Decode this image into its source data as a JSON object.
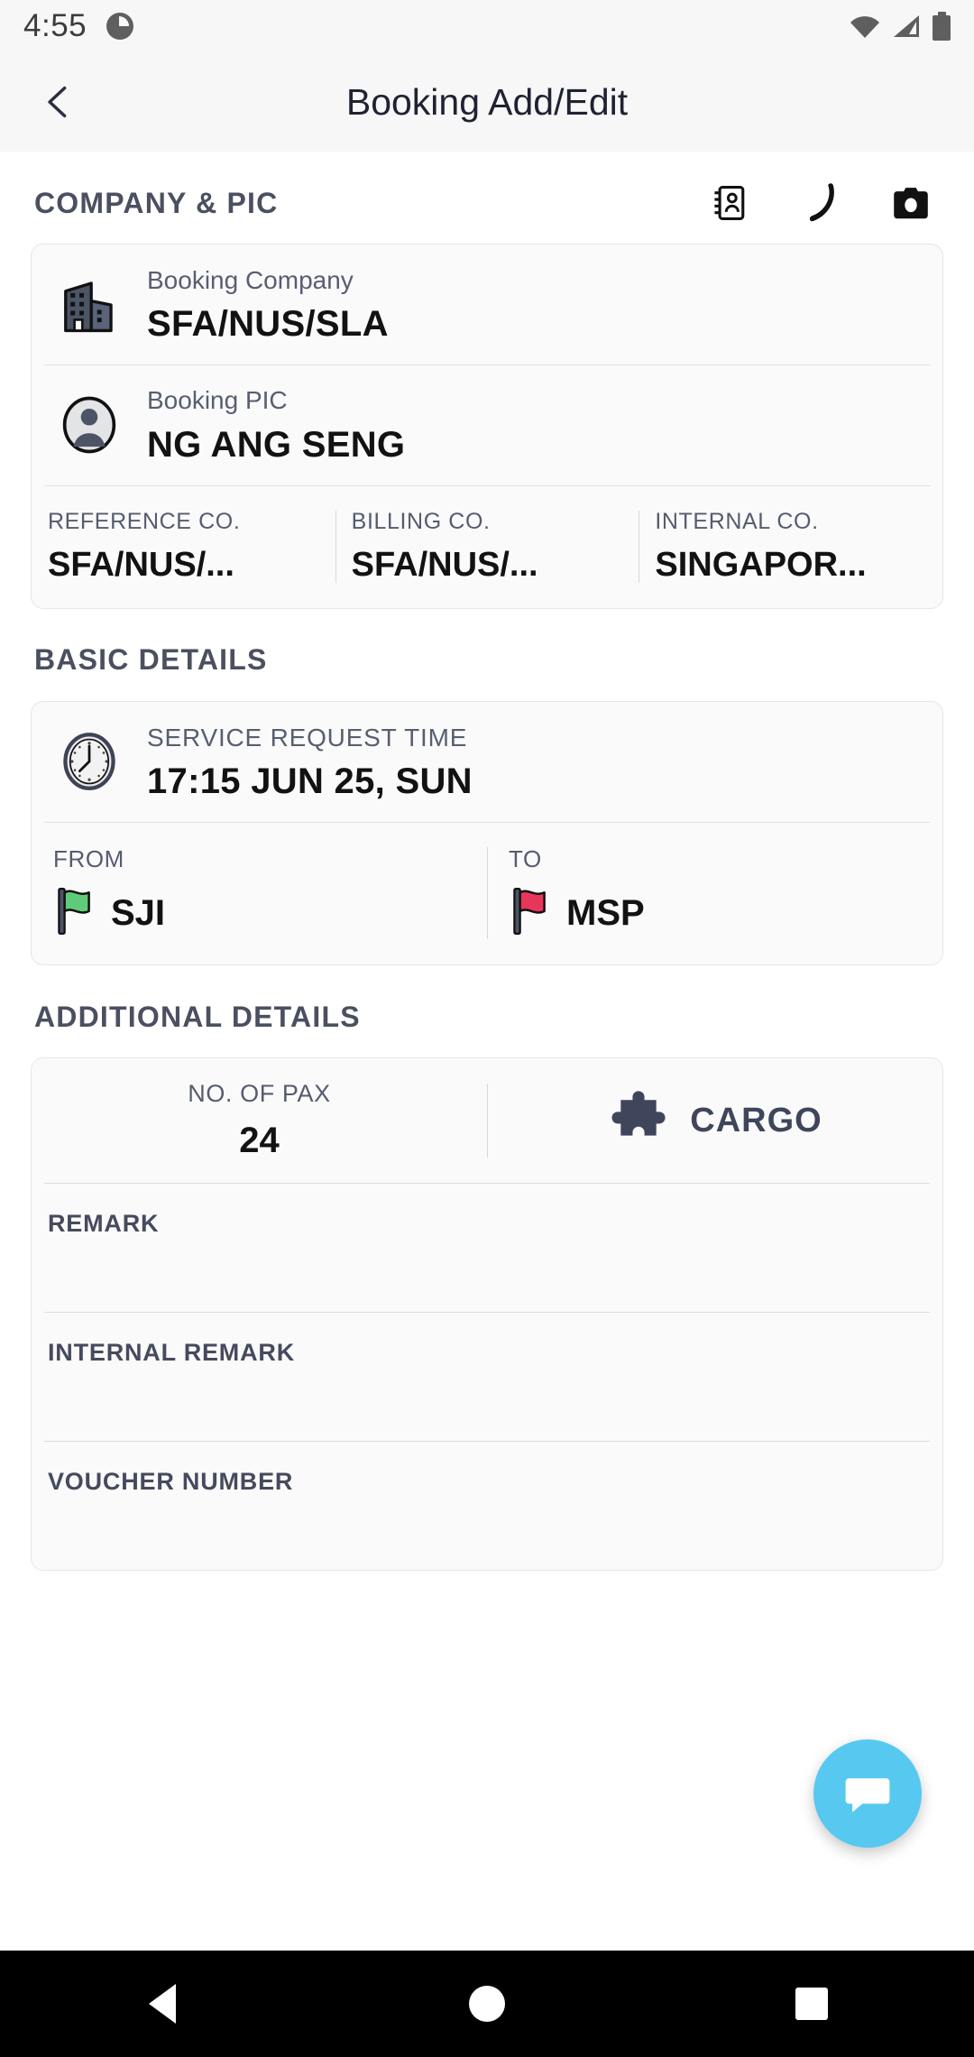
{
  "status_bar": {
    "time": "4:55",
    "icons": [
      "clock-badge-icon",
      "wifi-icon",
      "signal-icon",
      "battery-icon"
    ]
  },
  "app_bar": {
    "back_icon": "chevron-left-icon",
    "title": "Booking Add/Edit"
  },
  "sections": {
    "company_pic": {
      "title": "COMPANY & PIC",
      "actions": [
        "contact-card-icon",
        "phone-icon",
        "camera-icon"
      ],
      "booking_company": {
        "label": "Booking Company",
        "value": "SFA/NUS/SLA",
        "icon": "building-icon"
      },
      "booking_pic": {
        "label": "Booking PIC",
        "value": "NG ANG SENG",
        "icon": "person-avatar-icon"
      },
      "companies": [
        {
          "label": "REFERENCE CO.",
          "value": "SFA/NUS/..."
        },
        {
          "label": "BILLING CO.",
          "value": "SFA/NUS/..."
        },
        {
          "label": "INTERNAL CO.",
          "value": "SINGAPOR..."
        }
      ]
    },
    "basic_details": {
      "title": "BASIC DETAILS",
      "service_request_time": {
        "label": "SERVICE REQUEST TIME",
        "value": "17:15 JUN 25, SUN",
        "icon": "clock-icon"
      },
      "from": {
        "label": "FROM",
        "value": "SJI",
        "icon": "green-flag-icon",
        "color": "#5fcb79"
      },
      "to": {
        "label": "TO",
        "value": "MSP",
        "icon": "red-flag-icon",
        "color": "#e8365a"
      }
    },
    "additional_details": {
      "title": "ADDITIONAL DETAILS",
      "no_of_pax": {
        "label": "NO. OF PAX",
        "value": "24"
      },
      "cargo": {
        "label": "CARGO",
        "icon": "puzzle-piece-icon"
      },
      "remark": {
        "label": "REMARK",
        "value": ""
      },
      "internal_remark": {
        "label": "INTERNAL REMARK",
        "value": ""
      },
      "voucher_number": {
        "label": "VOUCHER NUMBER",
        "value": ""
      }
    }
  },
  "fab": {
    "icon": "chat-bubble-icon",
    "color": "#57c9f0"
  },
  "nav_bar": {
    "back": "nav-back-icon",
    "home": "nav-home-icon",
    "recents": "nav-recents-icon"
  }
}
